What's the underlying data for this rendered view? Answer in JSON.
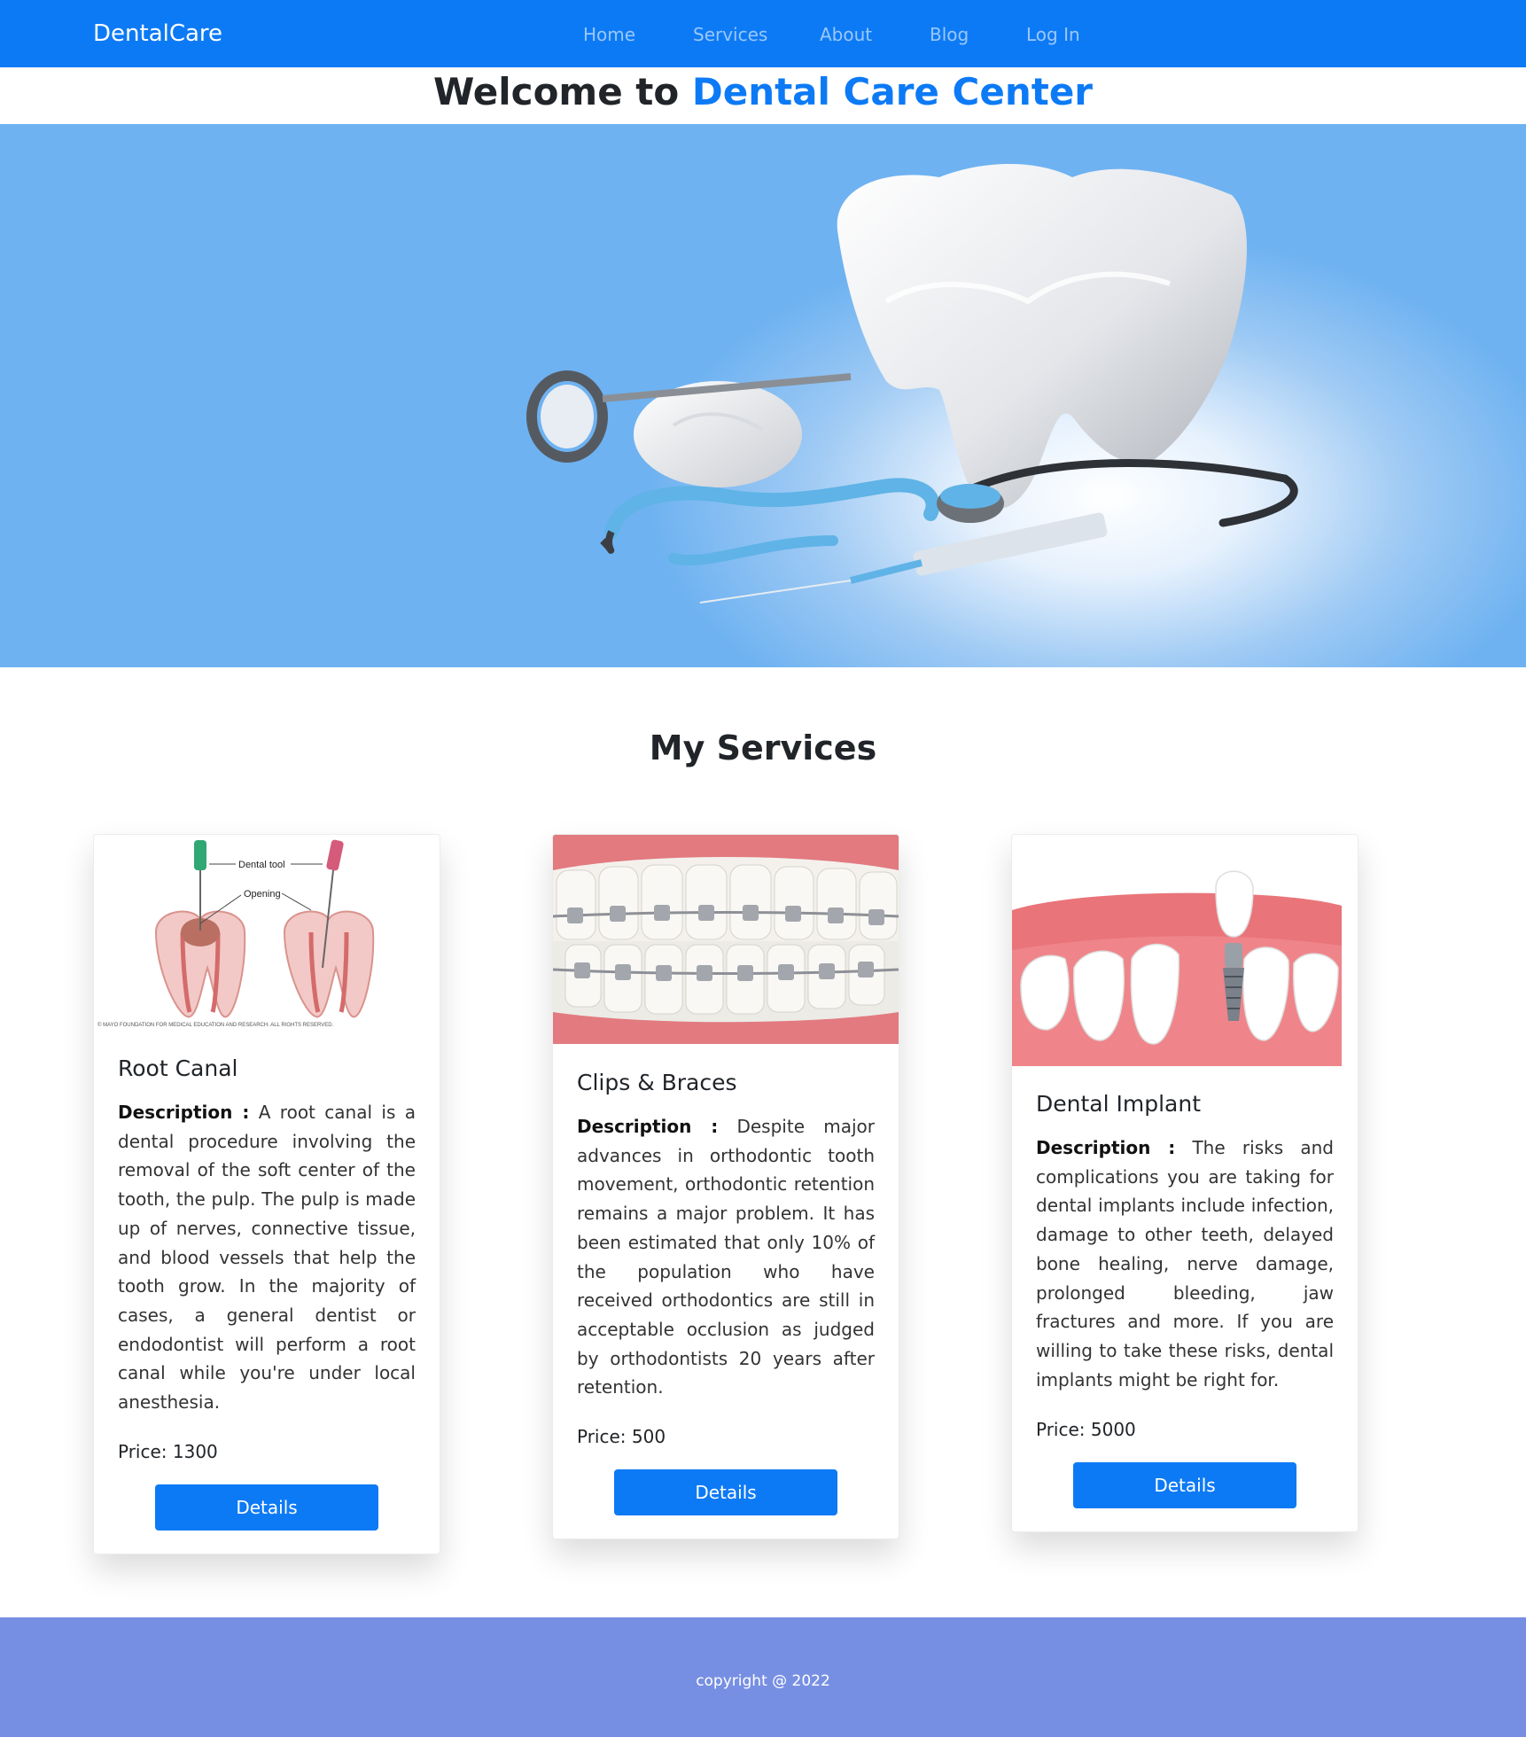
{
  "navbar": {
    "brand": "DentalCare",
    "links": [
      "Home",
      "Services",
      "About",
      "Blog",
      "Log In"
    ]
  },
  "welcome": {
    "prefix": "Welcome to ",
    "highlight": "Dental Care Center"
  },
  "hero": {
    "image": "dental-tools-hero"
  },
  "services": {
    "title": "My Services",
    "cards": [
      {
        "image": "root-canal-diagram",
        "image_labels": [
          "Dental tool",
          "Opening"
        ],
        "image_caption": "© MAYO FOUNDATION FOR MEDICAL EDUCATION AND RESEARCH. ALL RIGHTS RESERVED.",
        "title": "Root Canal",
        "desc_label": "Description :",
        "desc": "A root canal is a dental procedure involving the removal of the soft center of the tooth, the pulp. The pulp is made up of nerves, connective tissue, and blood vessels that help the tooth grow. In the majority of cases, a general dentist or endodontist will perform a root canal while you're under local anesthesia.",
        "price": "Price: 1300",
        "button": "Details"
      },
      {
        "image": "braces-photo",
        "title": "Clips & Braces",
        "desc_label": "Description :",
        "desc": "Despite major advances in orthodontic tooth movement, orthodontic retention remains a major problem. It has been estimated that only 10% of the population who have received orthodontics are still in acceptable occlusion as judged by orthodontists 20 years after retention.",
        "price": "Price: 500",
        "button": "Details"
      },
      {
        "image": "dental-implant-render",
        "title": "Dental Implant",
        "desc_label": "Description :",
        "desc": "The risks and complications you are taking for dental implants include infection, damage to other teeth, delayed bone healing, nerve damage, prolonged bleeding, jaw fractures and more. If you are willing to take these risks, dental implants might be right for.",
        "price": "Price: 5000",
        "button": "Details"
      }
    ]
  },
  "footer": {
    "copyright": "copyright @ 2022"
  },
  "colors": {
    "primary": "#0d7af5",
    "footer": "#778fe3",
    "hero_bg": "#6eb2f1"
  }
}
